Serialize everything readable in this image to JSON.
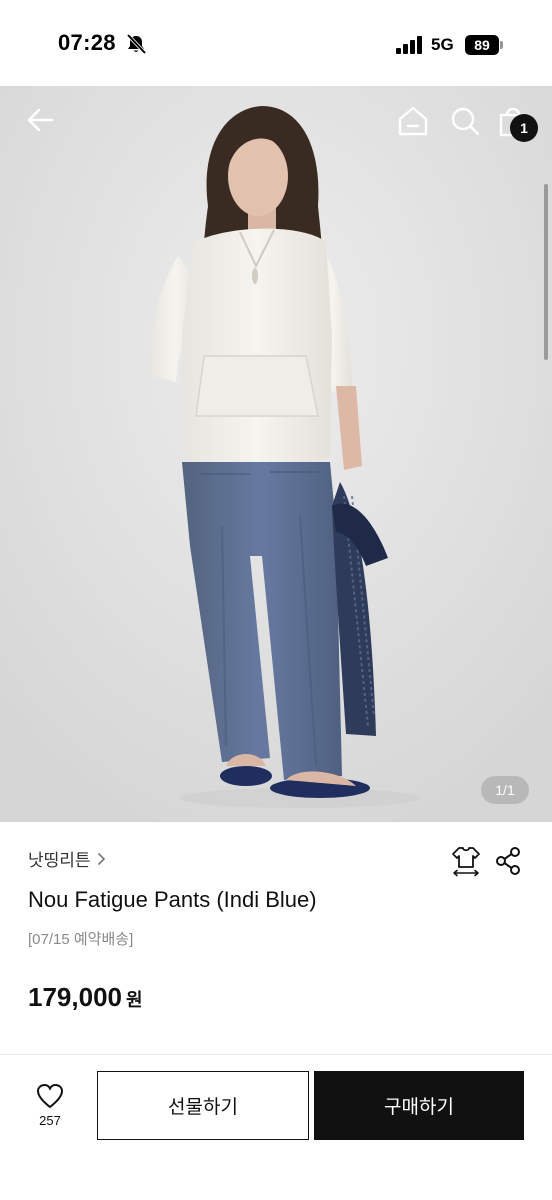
{
  "status_bar": {
    "time": "07:28",
    "network": "5G",
    "battery": "89"
  },
  "hero": {
    "page_indicator": "1/1",
    "bag_count": "1"
  },
  "product": {
    "brand": "낫띵리튼",
    "title": "Nou Fatigue Pants (Indi Blue)",
    "shipping_note": "[07/15 예약배송]",
    "price": "179,000",
    "price_unit": "원"
  },
  "bottom_bar": {
    "like_count": "257",
    "gift_label": "선물하기",
    "buy_label": "구매하기"
  },
  "colors": {
    "primary": "#111111",
    "badge": "#111111",
    "pants": "#5d6f8f",
    "shirt": "#f3f1ec"
  },
  "icons": [
    "bell-off-icon",
    "signal-icon",
    "battery-icon",
    "back-arrow-icon",
    "home-icon",
    "search-icon",
    "shopping-bag-icon",
    "chevron-right-icon",
    "size-guide-icon",
    "share-icon",
    "heart-icon"
  ]
}
